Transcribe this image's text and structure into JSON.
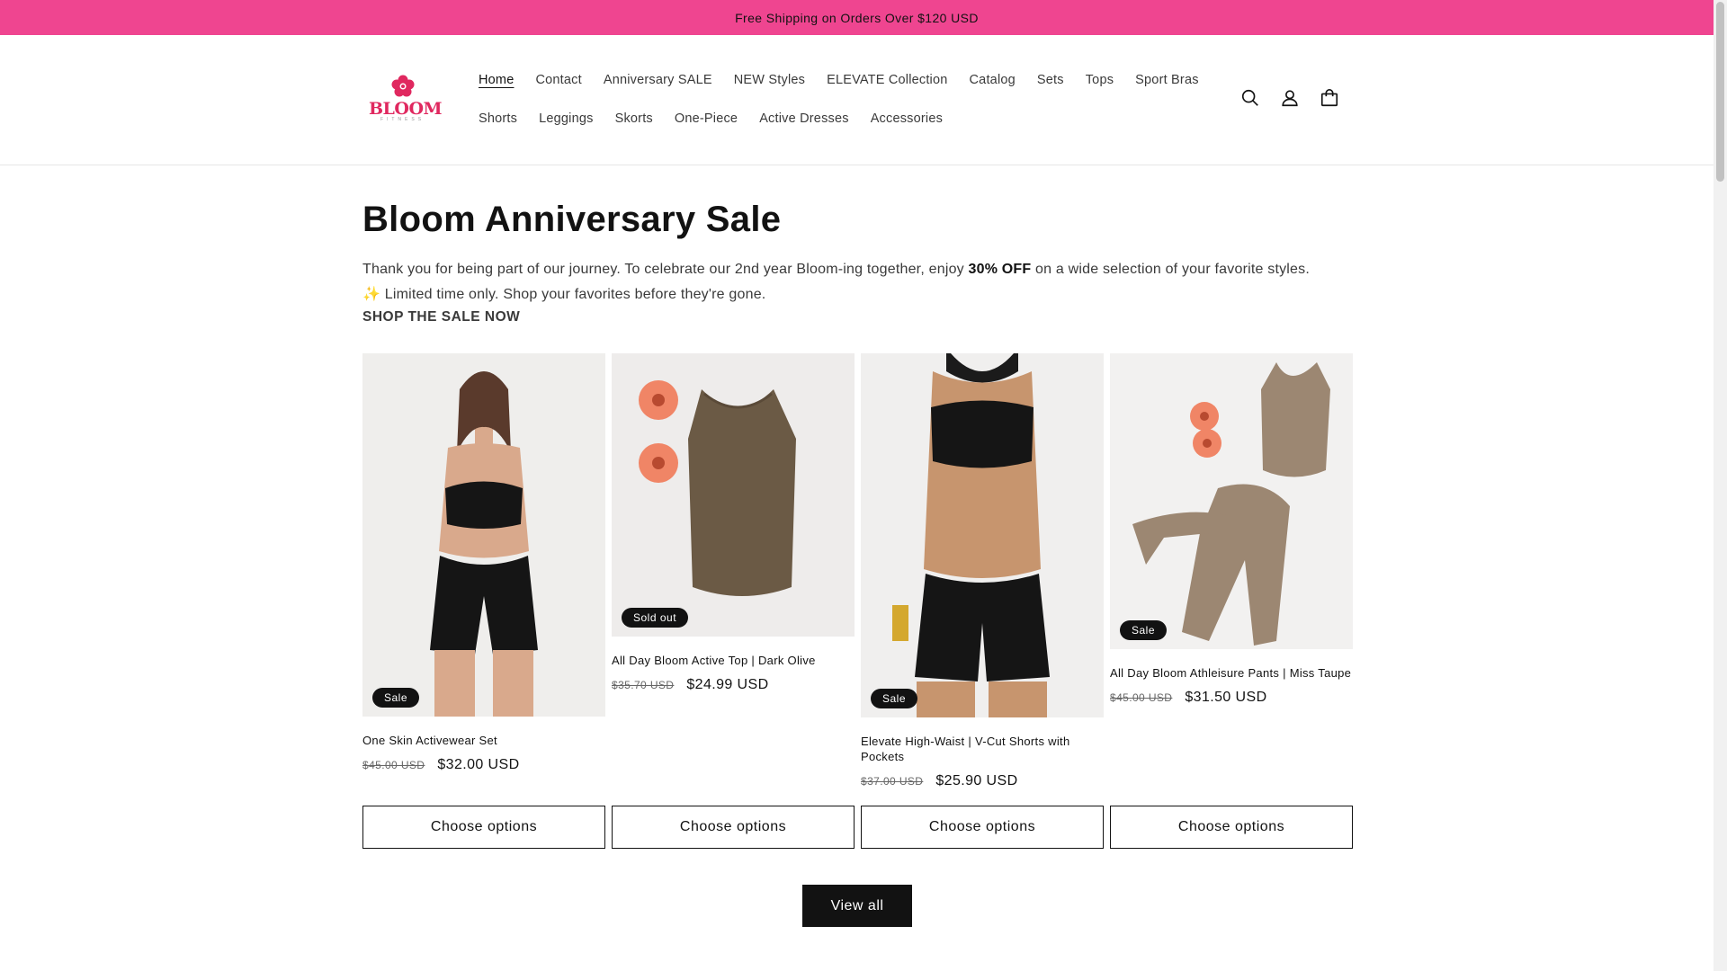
{
  "announcement": "Free Shipping on Orders Over $120 USD",
  "logo": {
    "text": "BLOOM",
    "subtext": "FITNESS"
  },
  "nav": {
    "row1": [
      "Home",
      "Contact",
      "Anniversary SALE",
      "NEW Styles",
      "ELEVATE Collection",
      "Catalog",
      "Sets",
      "Tops",
      "Sport Bras"
    ],
    "row2": [
      "Shorts",
      "Leggings",
      "Skorts",
      "One-Piece",
      "Active Dresses",
      "Accessories"
    ],
    "active": "Home"
  },
  "header_icons": [
    "search-icon",
    "account-icon",
    "cart-icon"
  ],
  "page": {
    "title": "Bloom Anniversary Sale",
    "desc_part1": "Thank you for being part of our journey. To celebrate our 2nd year Bloom-ing together, enjoy ",
    "desc_bold": "30% OFF",
    "desc_part2": " on a wide selection of your favorite styles.",
    "desc_line2": "✨ Limited time only. Shop your favorites before they're gone.",
    "shop_now": "SHOP THE SALE NOW"
  },
  "products": [
    {
      "name": "One Skin Activewear Set",
      "old_price": "$45.00 USD",
      "price": "$32.00 USD",
      "badge": "Sale",
      "button": "Choose options"
    },
    {
      "name": "All Day Bloom Active Top | Dark Olive",
      "old_price": "$35.70 USD",
      "price": "$24.99 USD",
      "badge": "Sold out",
      "button": "Choose options"
    },
    {
      "name": "Elevate High-Waist | V-Cut Shorts with Pockets",
      "old_price": "$37.00 USD",
      "price": "$25.90 USD",
      "badge": "Sale",
      "button": "Choose options"
    },
    {
      "name": "All Day Bloom Athleisure Pants | Miss Taupe",
      "old_price": "$45.00 USD",
      "price": "$31.50 USD",
      "badge": "Sale",
      "button": "Choose options"
    }
  ],
  "view_all": "View all",
  "colors": {
    "announcement_bg": "#ef4590",
    "brand": "#e0285f",
    "button_dark": "#121212"
  }
}
